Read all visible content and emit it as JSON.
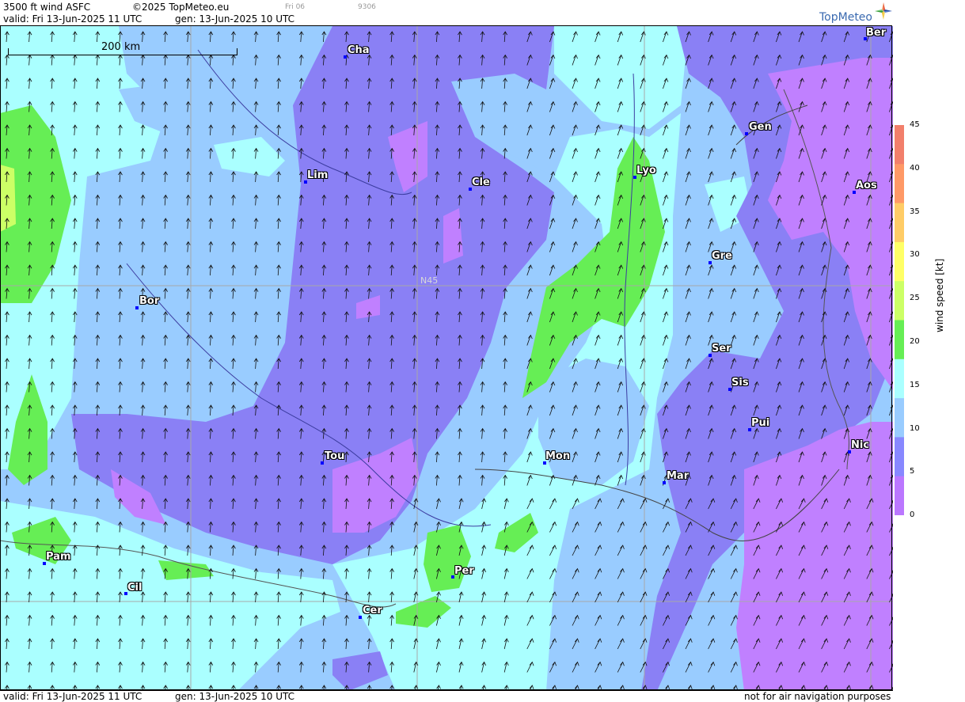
{
  "header": {
    "title": "3500 ft wind ASFC",
    "copyright": "©2025 TopMeteo.eu",
    "day_code": "Fri 06",
    "code": "9306",
    "valid": "valid:  Fri  13-Jun-2025  11 UTC",
    "generated": "gen: 13-Jun-2025 10 UTC"
  },
  "logo": {
    "text": "TopMeteo"
  },
  "scale": {
    "label": "200 km"
  },
  "latitude_label": "N45",
  "cities": [
    {
      "name": "Ber"
    },
    {
      "name": "Cha"
    },
    {
      "name": "Gen"
    },
    {
      "name": "Lim"
    },
    {
      "name": "Cle"
    },
    {
      "name": "Lyo"
    },
    {
      "name": "Aos"
    },
    {
      "name": "Gre"
    },
    {
      "name": "Bor"
    },
    {
      "name": "Ser"
    },
    {
      "name": "Sis"
    },
    {
      "name": "Pui"
    },
    {
      "name": "Tou"
    },
    {
      "name": "Mon"
    },
    {
      "name": "Nic"
    },
    {
      "name": "Mar"
    },
    {
      "name": "Pam"
    },
    {
      "name": "Per"
    },
    {
      "name": "Cil"
    },
    {
      "name": "Cer"
    }
  ],
  "legend": {
    "title": "wind speed [kt]",
    "ticks": [
      "45",
      "40",
      "35",
      "30",
      "25",
      "20",
      "15",
      "10",
      "5",
      "0"
    ],
    "colors": [
      "#f27f6b",
      "#ff9966",
      "#ffcc66",
      "#ffff66",
      "#ccff66",
      "#66ee55",
      "#aaffff",
      "#99ccff",
      "#8888ff",
      "#bb77ff"
    ]
  },
  "footer": {
    "valid": "valid:  Fri  13-Jun-2025  11 UTC",
    "generated": "gen: 13-Jun-2025 10 UTC",
    "note": "not for air navigation purposes"
  }
}
